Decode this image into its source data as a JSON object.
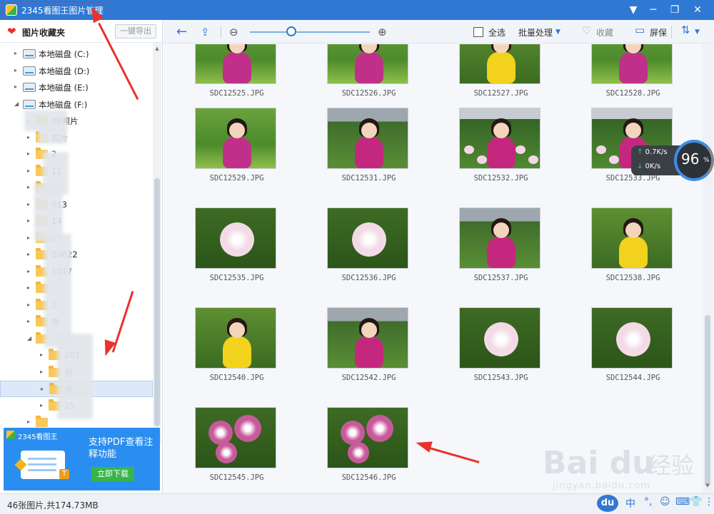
{
  "window": {
    "title": "2345看图王图片管理",
    "minimize": "▼",
    "shrink": "─",
    "restore": "❐",
    "close": "✕"
  },
  "sidebar": {
    "favorites_label": "图片收藏夹",
    "export_button": "一键导出",
    "tree": [
      {
        "label": "本地磁盘 (C:)",
        "type": "drive",
        "indent": 0,
        "expanded": false
      },
      {
        "label": "本地磁盘 (D:)",
        "type": "drive",
        "indent": 0,
        "expanded": false
      },
      {
        "label": "本地磁盘 (E:)",
        "type": "drive",
        "indent": 0,
        "expanded": false
      },
      {
        "label": "本地磁盘 (F:)",
        "type": "drive",
        "indent": 0,
        "expanded": true
      },
      {
        "label": "08照片",
        "type": "folder",
        "indent": 1,
        "expanded": false
      },
      {
        "label": "照片",
        "type": "folder",
        "indent": 1,
        "expanded": false
      },
      {
        "label": "2",
        "type": "folder",
        "indent": 1,
        "expanded": false
      },
      {
        "label": "11",
        "type": "folder",
        "indent": 1,
        "expanded": false
      },
      {
        "label": "",
        "type": "folder",
        "indent": 1,
        "expanded": false
      },
      {
        "label": "013",
        "type": "folder",
        "indent": 1,
        "expanded": false
      },
      {
        "label": "14",
        "type": "folder",
        "indent": 1,
        "expanded": false
      },
      {
        "label": "5",
        "type": "folder",
        "indent": 1,
        "expanded": false
      },
      {
        "label": "20622",
        "type": "folder",
        "indent": 1,
        "expanded": false
      },
      {
        "label": "1017",
        "type": "folder",
        "indent": 1,
        "expanded": false
      },
      {
        "label": "",
        "type": "folder",
        "indent": 1,
        "expanded": false
      },
      {
        "label": "1",
        "type": "folder",
        "indent": 1,
        "expanded": false
      },
      {
        "label": "夹",
        "type": "folder",
        "indent": 1,
        "expanded": false
      },
      {
        "label": "",
        "type": "folder",
        "indent": 1,
        "expanded": true
      },
      {
        "label": "201",
        "type": "folder",
        "indent": 2,
        "expanded": false
      },
      {
        "label": "照",
        "type": "folder",
        "indent": 2,
        "expanded": false
      },
      {
        "label": "片",
        "type": "folder",
        "indent": 2,
        "expanded": false,
        "selected": true
      },
      {
        "label": "15",
        "type": "folder",
        "indent": 2,
        "expanded": false
      },
      {
        "label": "",
        "type": "folder",
        "indent": 1,
        "expanded": false
      }
    ],
    "ad": {
      "brand": "2345看图王",
      "headline": "支持PDF查看注释功能",
      "download_button": "立即下载"
    }
  },
  "toolbar": {
    "back_icon": "←",
    "upload_icon": "⇪",
    "zoom_out": "⊖",
    "zoom_in": "⊕",
    "zoom_level": 0.3,
    "select_all": "全选",
    "batch": "批量处理",
    "favorite": "收藏",
    "screen": "屏保",
    "heart_icon": "♡",
    "monitor_icon": "▭",
    "sort_icon": "⇅"
  },
  "thumbnails": [
    {
      "name": "SDC12525.JPG",
      "scene": "girl-grass"
    },
    {
      "name": "SDC12526.JPG",
      "scene": "girl-grass"
    },
    {
      "name": "SDC12527.JPG",
      "scene": "girl-yellow"
    },
    {
      "name": "SDC12528.JPG",
      "scene": "girl-grass"
    },
    {
      "name": "SDC12529.JPG",
      "scene": "girl-grass"
    },
    {
      "name": "SDC12531.JPG",
      "scene": "girl-pink"
    },
    {
      "name": "SDC12532.JPG",
      "scene": "girl-flowers"
    },
    {
      "name": "SDC12533.JPG",
      "scene": "girl-flowers"
    },
    {
      "name": "SDC12535.JPG",
      "scene": "peony-white"
    },
    {
      "name": "SDC12536.JPG",
      "scene": "peony-white"
    },
    {
      "name": "SDC12537.JPG",
      "scene": "girl-pink"
    },
    {
      "name": "SDC12538.JPG",
      "scene": "girl-yellow"
    },
    {
      "name": "SDC12540.JPG",
      "scene": "girl-yellow"
    },
    {
      "name": "SDC12542.JPG",
      "scene": "girl-pink"
    },
    {
      "name": "SDC12543.JPG",
      "scene": "peony-white"
    },
    {
      "name": "SDC12544.JPG",
      "scene": "peony-white"
    },
    {
      "name": "SDC12545.JPG",
      "scene": "peony-pink"
    },
    {
      "name": "SDC12546.JPG",
      "scene": "peony-pink"
    }
  ],
  "status": {
    "text": "46张图片,共174.73MB"
  },
  "net_widget": {
    "upload": "0.7K/s",
    "download": "0K/s",
    "percent": "96",
    "percent_sign": "%"
  },
  "watermark": {
    "logo": "Bai du",
    "text": "经验",
    "url": "jingyan.baidu.com"
  },
  "ime": {
    "logo": "du",
    "keys": [
      "中",
      "°,",
      "☺",
      "⌨",
      "👕",
      "⋮⋮"
    ]
  }
}
